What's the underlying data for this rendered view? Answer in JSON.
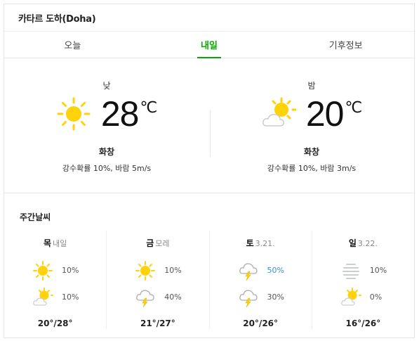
{
  "header": {
    "location": "카타르 도하(Doha)"
  },
  "tabs": [
    {
      "label": "오늘"
    },
    {
      "label": "내일"
    },
    {
      "label": "기후정보"
    }
  ],
  "tomorrow": {
    "day": {
      "label": "낮",
      "temp": "28",
      "unit": "℃",
      "condition": "화창",
      "detail": "강수확률 10%, 바람 5m/s",
      "icon": "sun-icon"
    },
    "night": {
      "label": "밤",
      "temp": "20",
      "unit": "℃",
      "condition": "화창",
      "detail": "강수확률 10%, 바람 3m/s",
      "icon": "partly-cloudy-icon"
    }
  },
  "weekly": {
    "title": "주간날씨",
    "days": [
      {
        "name": "목",
        "sub": "내일",
        "am": {
          "icon": "sun-icon",
          "pct": "10%"
        },
        "pm": {
          "icon": "partly-cloudy-icon",
          "pct": "10%"
        },
        "range": "20°/28°"
      },
      {
        "name": "금",
        "sub": "모레",
        "am": {
          "icon": "sun-icon",
          "pct": "10%"
        },
        "pm": {
          "icon": "thunderstorm-icon",
          "pct": "40%"
        },
        "range": "21°/27°"
      },
      {
        "name": "토",
        "sub": "3.21.",
        "am": {
          "icon": "thunderstorm-icon",
          "pct": "50%"
        },
        "pm": {
          "icon": "thunderstorm-icon",
          "pct": "30%"
        },
        "range": "20°/26°"
      },
      {
        "name": "일",
        "sub": "3.22.",
        "am": {
          "icon": "haze-icon",
          "pct": "10%"
        },
        "pm": {
          "icon": "partly-cloudy-icon",
          "pct": "0%"
        },
        "range": "16°/26°"
      }
    ]
  },
  "colors": {
    "accent": "#08a600",
    "rain": "#3a8fd6",
    "sun": "#ffd20a"
  }
}
